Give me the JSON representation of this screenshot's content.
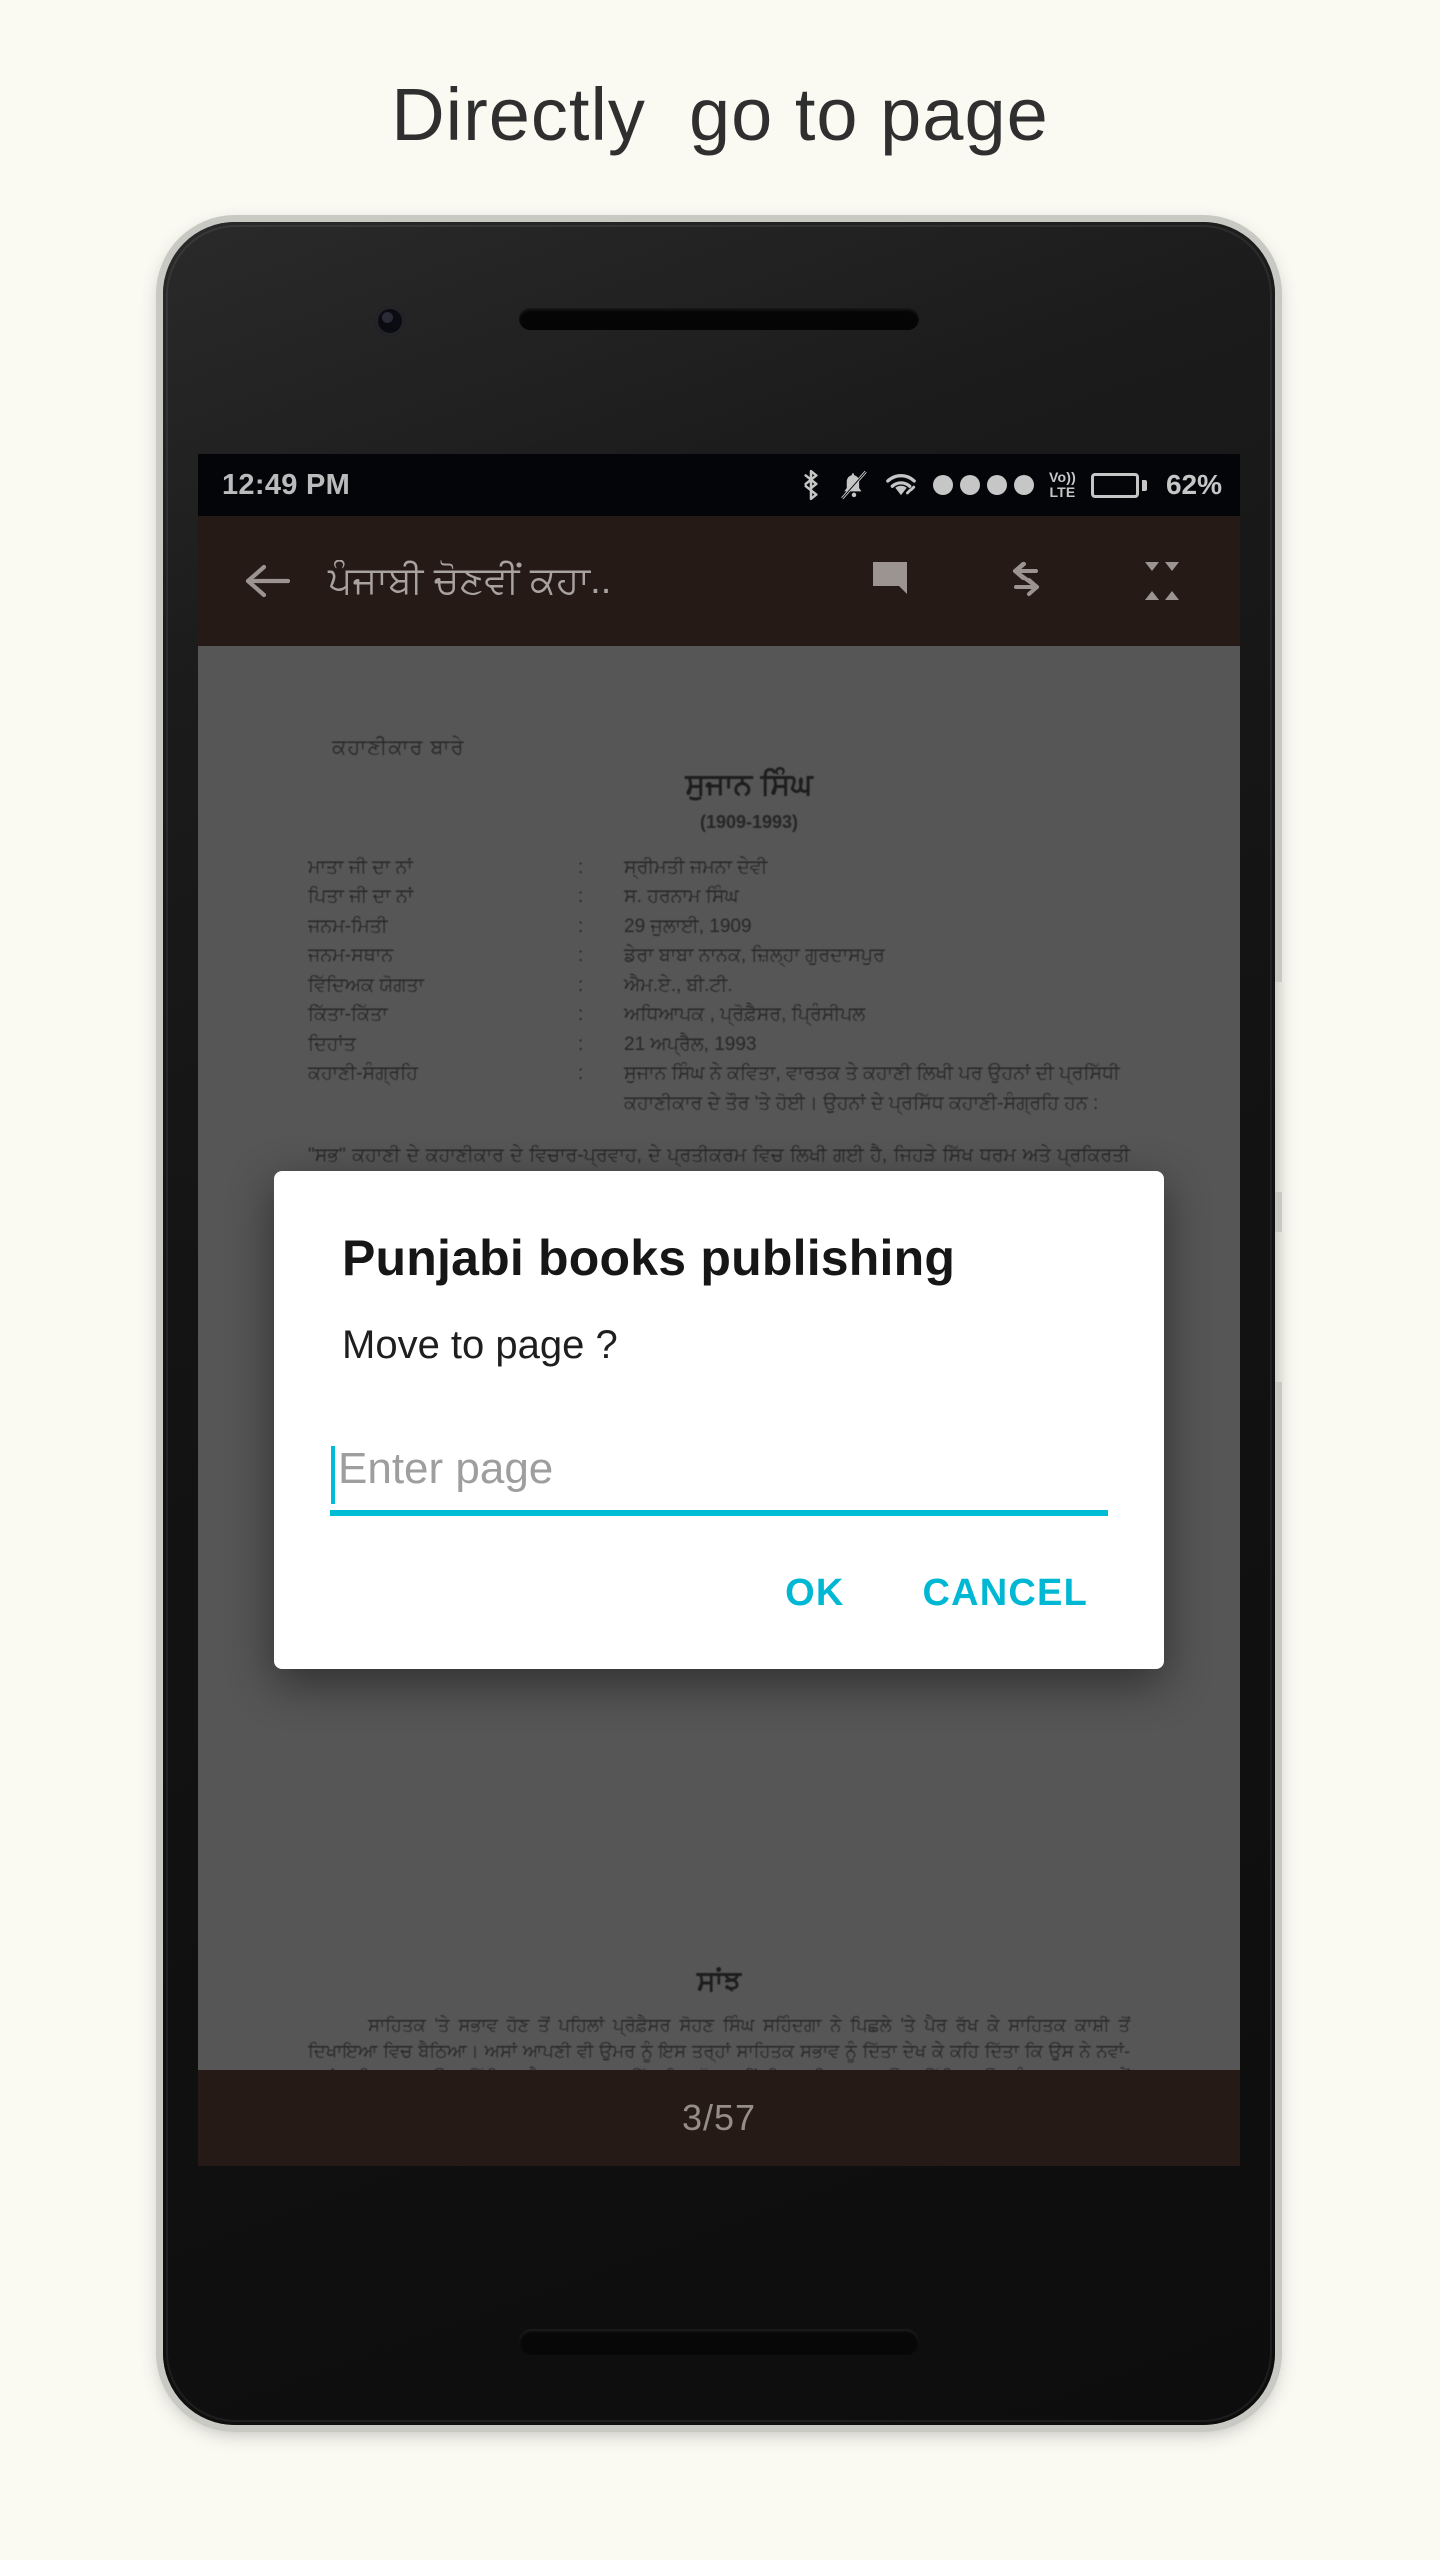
{
  "headline": "Directly  go to page",
  "colors": {
    "page_background": "#fafaf2",
    "toolbar": "#2e201b",
    "accent": "#00bcd4",
    "status_bar": "#05070c",
    "content_gray": "#666666"
  },
  "status_bar": {
    "time": "12:49 PM",
    "battery_percent": "62%",
    "battery_level": 62,
    "network_label": "Vo)\nLTE",
    "volte_top": "Vo))",
    "volte_bottom": "LTE",
    "signal_dots": 4,
    "icons": [
      "bluetooth-icon",
      "mute-bell-icon",
      "wifi-icon",
      "signal-dots",
      "volte-icon",
      "battery-icon"
    ]
  },
  "toolbar": {
    "back_label": "back-arrow",
    "title": "ਪੰਜਾਬੀ ਚੋਣਵੀਂ ਕਹਾ..",
    "actions": [
      "bookmark-icon",
      "swap-arrows-icon",
      "fullscreen-icon"
    ]
  },
  "book_page": {
    "label": "ਕਹਾਣੀਕਾਰ ਬਾਰੇ",
    "author": "ਸੁਜਾਨ ਸਿੰਘ",
    "years": "(1909-1993)",
    "rows": [
      {
        "key": "ਮਾਤਾ ਜੀ ਦਾ ਨਾਂ",
        "sep": ":",
        "value": "ਸ੍ਰੀਮਤੀ ਜਮਨਾ ਦੇਵੀ"
      },
      {
        "key": "ਪਿਤਾ ਜੀ ਦਾ ਨਾਂ",
        "sep": ":",
        "value": "ਸ. ਹਰਨਾਮ ਸਿੰਘ"
      },
      {
        "key": "ਜਨਮ-ਮਿਤੀ",
        "sep": ":",
        "value": "29 ਜੁਲਾਈ, 1909"
      },
      {
        "key": "ਜਨਮ-ਸਥਾਨ",
        "sep": ":",
        "value": "ਡੇਰਾ ਬਾਬਾ ਨਾਨਕ, ਜ਼ਿਲ੍ਹਾ ਗੁਰਦਾਸਪੁਰ"
      },
      {
        "key": "ਵਿੱਦਿਅਕ ਯੋਗਤਾ",
        "sep": ":",
        "value": "ਐਮ.ਏ., ਬੀ.ਟੀ."
      },
      {
        "key": "ਕਿੱਤਾ-ਕਿੱਤਾ",
        "sep": ":",
        "value": "ਅਧਿਆਪਕ , ਪ੍ਰੋਫ਼ੈਸਰ, ਪ੍ਰਿੰਸੀਪਲ"
      },
      {
        "key": "ਦਿਹਾਂਤ",
        "sep": ":",
        "value": "21 ਅਪ੍ਰੈਲ, 1993"
      },
      {
        "key": "ਕਹਾਣੀ-ਸੰਗ੍ਰਹਿ",
        "sep": ":",
        "value": "ਸੁਜਾਨ ਸਿੰਘ ਨੇ ਕਵਿਤਾ, ਵਾਰਤਕ ਤੇ ਕਹਾਣੀ ਲਿਖੀ ਪਰ ਉਹਨਾਂ ਦੀ ਪ੍ਰਸਿੱਧੀ ਕਹਾਣੀਕਾਰ ਦੇ ਤੌਰ 'ਤੇ ਹੋਈ। ਉਹਨਾਂ ਦੇ ਪ੍ਰਸਿੱਧ ਕਹਾਣੀ-ਸੰਗ੍ਰਹਿ ਹਨ :"
      }
    ],
    "paragraph": "\"ਸਭ\" ਕਹਾਣੀ ਦੇ ਕਹਾਣੀਕਾਰ ਦੇ ਵਿਚਾਰ-ਪ੍ਰਵਾਹ, ਦੇ ਪ੍ਰਤੀਕਰਮ ਵਿਚ ਲਿਖੀ ਗਈ ਹੈ, ਜਿਹੜੇ ਸਿੱਖ ਧਰਮ ਅਤੇ ਪ੍ਰਕਿਰਤੀ ਵਿਚ ਮਨੁੱਖ ਅਤੇ ਸਮਾਜ ਦੇ ਰਿਸ਼ਤੇ ਦੀ ਗੱਲ ਕਰਦੇ ਹਨ।"
  },
  "book_page_bottom": {
    "title": "ਸਾਂਝ",
    "paragraph": "ਸਾਹਿਤਕ 'ਤੇ ਸਭਾਵ ਹੋਣ ਤੋਂ ਪਹਿਲਾਂ ਪ੍ਰੋਫ਼ੈਸਰ ਸੋਹਣ ਸਿੰਘ ਸਹਿੰਦਗਾ ਨੇ ਪਿਛਲੇ 'ਤੇ ਪੈਰ ਰੱਖ ਕੇ ਸਾਹਿਤਕ ਕਾਸ਼ੀ ਤੋਂ ਦਿਖਾਇਆ ਵਿਚ ਬੈਠਿਆ। ਅਸਾਂ ਆਪਣੀ ਵੀ ਉਮਰ ਨੂੰ ਇਸ ਤਰ੍ਹਾਂ ਸਾਹਿਤਕ ਸਭਾਵ ਨੂੰ ਦਿੱਤਾ ਦੇਖ ਕੇ ਕਹਿ ਦਿੱਤਾ ਕਿ ਉਸ ਨੇ ਨਵਾਂ-ਨਵਾਂ ਸਾਹਿਤਕ ਖ਼ਮਾਉਣਾ ਸਿੱਖਿਆ ਹੈ। ਪਰ ਅਸਮ ਵਿੱਚ ਇਹ ਗੱਲ ਨਹੀਂ ਸੀ। ਸਾਹਿਤਕ ਖ਼ਮਾਉਣਾ ਸਿੱਖਿਆ ਉਸ ਨੂੰ ਭਲਾ-ਪੜ੍ਹ ਸਮੇਂ ਸਾਲ ਹੋ ਚੁੱਕੇ ਸਨ ਅਤੇ ਉਹ ਵਾਹਵਾ ਸਾਫ਼ ਸਾਹਿਤਕ ਚਲਾ ਸਕਦਾ ਸੀ। ਇਹ ਮਹਿਕ ਨਹੀਂ ਸੀ। ਪਰ ਪ੍ਰੋਫ਼ੈਸਰ ਜੀਵਨ ਕਈ ਮਹਿਲਾਂ ਤੋਂ ਬੋਲਾ ਬਦਲਾਵਾਂ ਵਿੱਚੋਂ ਵੀ ਬਿਨਾਂ ਰੋਕੀ ਖਤਮਾਣਿਆ ਆਪਣਾ ਵਿਚਾਰ-ਯੁਕਤਿਕਾ ਕਾਹ ਪ੍ਰਦਾ ਲੱਖ ਜਾਣਾ ਸੀ।"
  },
  "page_indicator": "3/57",
  "dialog": {
    "title": "Punjabi books publishing",
    "message": "Move to page ?",
    "input_placeholder": "Enter page",
    "input_value": "",
    "ok_label": "OK",
    "cancel_label": "CANCEL"
  }
}
